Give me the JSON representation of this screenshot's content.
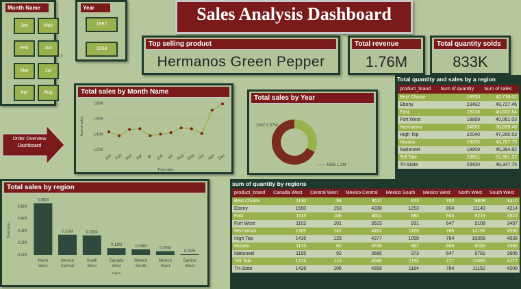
{
  "header": {
    "title": "Sales Analysis Dashboard"
  },
  "month_slicer": {
    "title": "Month Name",
    "months": [
      "Jan",
      "May",
      "Feb",
      "Jun",
      "Mar",
      "Jul",
      "Apr",
      "Aug"
    ]
  },
  "year_slicer": {
    "title": "Year",
    "years": [
      "1997",
      "1998"
    ]
  },
  "kpis": {
    "top_product_title": "Top selling product",
    "top_product_value": "Hermanos Green Pepper",
    "revenue_title": "Total revenue",
    "revenue_value": "1.76M",
    "quantity_title": "Total quantity solds",
    "quantity_value": "833K"
  },
  "nav_button": {
    "label": "Order Overview Dashboard"
  },
  "colors": {
    "maroon": "#7a1a1a",
    "green": "#9ab24e",
    "dark": "#1f3a2c",
    "background": "#b7c79c",
    "bar": "#2f4a3c"
  },
  "chart_data": [
    {
      "type": "line",
      "title": "Total sales by Month Name",
      "xlabel": "Total sales",
      "ylabel": "Sum of sales",
      "categories": [
        "Jan",
        "Feb",
        "Mar",
        "Apr",
        "M",
        "Jun",
        "Jul",
        "Aug",
        "Sep",
        "Oct",
        "Nov",
        "Dec"
      ],
      "values": [
        143000,
        138000,
        146000,
        147000,
        138000,
        140000,
        142000,
        148000,
        147000,
        141000,
        171000,
        179000
      ],
      "ytick_labels": [
        "180K",
        "160K",
        "140K",
        "120K"
      ],
      "ylim": [
        120000,
        180000
      ],
      "color": "#9ab24e",
      "point_color": "#7a1a1a"
    },
    {
      "type": "pie",
      "title": "Total sales by Year",
      "labels": [
        "1997",
        "1998"
      ],
      "values": [
        0.57,
        1.2
      ],
      "data_labels": [
        "1997 0.57M",
        "1998 1.2M"
      ],
      "colors": [
        "#9ab24e",
        "#7a2a1e"
      ]
    },
    {
      "type": "bar",
      "title": "Total sales by region",
      "xlabel": "region",
      "ylabel": "Total sales",
      "categories": [
        "North West",
        "Mexico Central",
        "South West",
        "Canada West",
        "Mexico South",
        "Mexico West",
        "Central West"
      ],
      "values": [
        0.85,
        0.33,
        0.32,
        0.11,
        0.09,
        0.06,
        0.01
      ],
      "data_labels": [
        "0.85M",
        "0.33M",
        "0.32M",
        "0.11M",
        "0.09M",
        "0.06M",
        "0.01M"
      ],
      "ytick_labels": [
        "0.8M",
        "0.6M",
        "0.4M",
        "0.2M",
        "0.0M"
      ],
      "ylim": [
        0,
        0.9
      ],
      "color": "#2f4a3c"
    }
  ],
  "qty_sales_table": {
    "title": "Total quantity and sales by a region",
    "columns": [
      "product_brand",
      "Sum of quantity",
      "Sum of sales"
    ],
    "rows": [
      [
        "Best Choice",
        "18553",
        "42,738.02"
      ],
      [
        "Ebony",
        "23492",
        "49,727.46"
      ],
      [
        "Fast",
        "19118",
        "40,532.84"
      ],
      [
        "Fort West",
        "18869",
        "40,061.03"
      ],
      [
        "Hermanos",
        "24682",
        "56,659.48"
      ],
      [
        "High Top",
        "22040",
        "47,200.53"
      ],
      [
        "Horatio",
        "19205",
        "43,787.75"
      ],
      [
        "Nationeel",
        "19959",
        "45,384.82"
      ],
      [
        "Tell Tale",
        "23801",
        "51,561.22"
      ],
      [
        "Tri-State",
        "23400",
        "49,347.75"
      ]
    ]
  },
  "region_table": {
    "title": "sum of quantity by regions",
    "columns": [
      "product_brand",
      "Canada West",
      "Central West",
      "Mexico Central",
      "Mexico South",
      "Mexico West",
      "North West",
      "South West"
    ],
    "rows": [
      [
        "Best Choice",
        "1130",
        "98",
        "3611",
        "833",
        "763",
        "8808",
        "3310"
      ],
      [
        "Ebony",
        "1590",
        "153",
        "4338",
        "1253",
        "804",
        "11140",
        "4214"
      ],
      [
        "Fast",
        "1113",
        "106",
        "3601",
        "894",
        "663",
        "9219",
        "3522"
      ],
      [
        "Fort West",
        "1102",
        "101",
        "3523",
        "931",
        "647",
        "9108",
        "3457"
      ],
      [
        "Hermanos",
        "1385",
        "141",
        "4462",
        "1180",
        "786",
        "12192",
        "4536"
      ],
      [
        "High Top",
        "1415",
        "129",
        "4277",
        "1059",
        "764",
        "10358",
        "4038"
      ],
      [
        "Horatio",
        "1173",
        "82",
        "3749",
        "967",
        "668",
        "9200",
        "3366"
      ],
      [
        "Nationeel",
        "1195",
        "92",
        "3666",
        "973",
        "647",
        "9781",
        "3605"
      ],
      [
        "Tell Tale",
        "1374",
        "115",
        "4546",
        "1192",
        "717",
        "11680",
        "4177"
      ],
      [
        "Tri-State",
        "1428",
        "105",
        "4559",
        "1184",
        "764",
        "11152",
        "4208"
      ]
    ]
  }
}
